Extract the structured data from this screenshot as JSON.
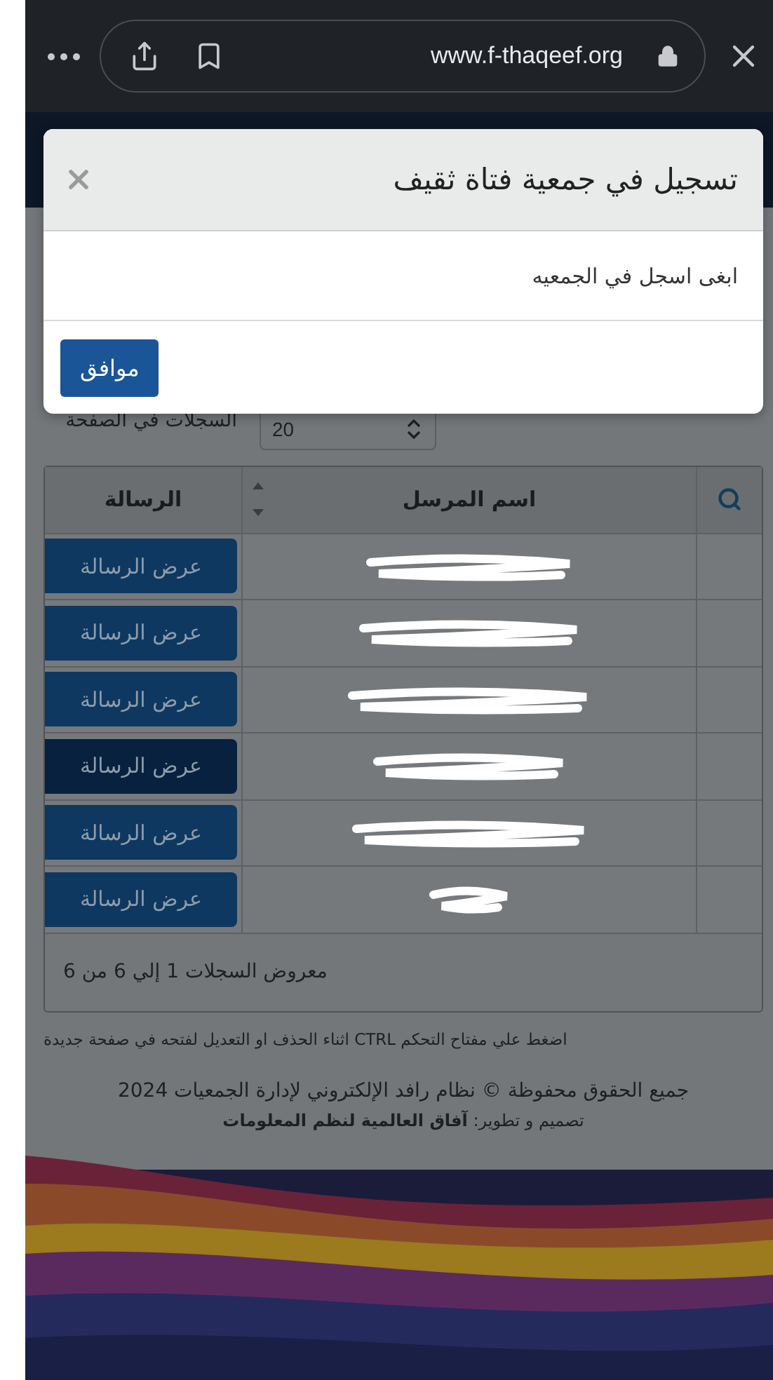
{
  "browser": {
    "url": "www.f-thaqeef.org",
    "secure": true
  },
  "dialog": {
    "title": "تسجيل في جمعية فتاة ثقيف",
    "message": "ابغى اسجل في الجمعيه",
    "buttons": [
      {
        "label": "موافق"
      }
    ]
  },
  "page_size": {
    "label": "السجلات في الصفحة",
    "value": "20"
  },
  "table": {
    "columns": [
      {
        "label": "اسم المرسل",
        "sortable": true
      },
      {
        "label": "الرسالة",
        "sortable": false
      }
    ],
    "rows": [
      {
        "sender_redacted": true,
        "action": "عرض الرسالة",
        "focused": false
      },
      {
        "sender_redacted": true,
        "action": "عرض الرسالة",
        "focused": false
      },
      {
        "sender_redacted": true,
        "action": "عرض الرسالة",
        "focused": false
      },
      {
        "sender_redacted": true,
        "action": "عرض الرسالة",
        "focused": true
      },
      {
        "sender_redacted": true,
        "action": "عرض الرسالة",
        "focused": false
      },
      {
        "sender_redacted": true,
        "action": "عرض الرسالة",
        "focused": false
      }
    ],
    "summary": "معروض السجلات 1 إلي 6 من 6"
  },
  "note": "اضغط علي مفتاح التحكم CTRL اثناء الحذف او التعديل لفتحه في صفحة جديدة",
  "copyright": "جميع الحقوق محفوظة © نظام رافد الإلكتروني لإدارة الجمعيات 2024",
  "credit": "تصميم و تطوير: **آفاق العالمية لنظم المعلومات**"
}
